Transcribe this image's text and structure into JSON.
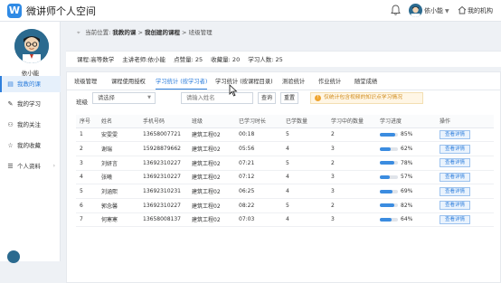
{
  "header": {
    "logo_letter": "W",
    "title": "微讲师个人空间",
    "user_name": "依小能",
    "org_label": "我的机构"
  },
  "sidebar": {
    "user_name": "依小能",
    "items": [
      {
        "label": "我教的课",
        "icon": "book-icon",
        "glyph": "▤"
      },
      {
        "label": "我的学习",
        "icon": "study-icon",
        "glyph": "✎"
      },
      {
        "label": "我的关注",
        "icon": "person-icon",
        "glyph": "⚇"
      },
      {
        "label": "我的收藏",
        "icon": "star-icon",
        "glyph": "☆"
      },
      {
        "label": "个人资料",
        "icon": "profile-icon",
        "glyph": "☰"
      }
    ]
  },
  "breadcrumb": {
    "prefix": "当前位置:",
    "level1": "我教的课",
    "sep": ">",
    "level2": "我创建的课程",
    "level3": "班级管理"
  },
  "course_info": {
    "course": "课程:高等数学",
    "teacher": "主讲老师:依小能",
    "likes": "点赞量: 25",
    "favorites": "收藏量: 20",
    "learners": "学习人数: 25"
  },
  "tabs": [
    {
      "label": "班级管理"
    },
    {
      "label": "课程使用授权"
    },
    {
      "label": "学习统计 (按学习者)"
    },
    {
      "label": "学习统计 (按课程目录)"
    },
    {
      "label": "测验统计"
    },
    {
      "label": "作业统计"
    },
    {
      "label": "随堂成绩"
    }
  ],
  "filters": {
    "class_label": "班级",
    "class_select": "请选择",
    "search_placeholder": "请输入姓名",
    "query_button": "查询",
    "reset_button": "重置",
    "notice": "仅统计包含视频的知识点学习情况"
  },
  "table": {
    "headers": [
      "序号",
      "姓名",
      "手机号码",
      "班级",
      "已学习时长",
      "已学数量",
      "学习中的数量",
      "学习进度",
      "操作"
    ],
    "rows": [
      {
        "no": "1",
        "name": "安雯雯",
        "phone": "13658007721",
        "class": "建筑工程02",
        "time": "00:18",
        "done": "5",
        "learning": "2",
        "progress": "85%",
        "pct": 0.85,
        "action": "查看详情"
      },
      {
        "no": "2",
        "name": "谢瑞",
        "phone": "15928879662",
        "class": "建筑工程02",
        "time": "05:56",
        "done": "4",
        "learning": "3",
        "progress": "62%",
        "pct": 0.62,
        "action": "查看详情"
      },
      {
        "no": "3",
        "name": "刘妍言",
        "phone": "13692310227",
        "class": "建筑工程02",
        "time": "07:21",
        "done": "5",
        "learning": "2",
        "progress": "78%",
        "pct": 0.78,
        "action": "查看详情"
      },
      {
        "no": "4",
        "name": "张曦",
        "phone": "13692310227",
        "class": "建筑工程02",
        "time": "07:12",
        "done": "4",
        "learning": "3",
        "progress": "57%",
        "pct": 0.57,
        "action": "查看详情"
      },
      {
        "no": "5",
        "name": "刘涵熙",
        "phone": "13692310231",
        "class": "建筑工程02",
        "time": "06:25",
        "done": "4",
        "learning": "3",
        "progress": "69%",
        "pct": 0.69,
        "action": "查看详情"
      },
      {
        "no": "6",
        "name": "郭念馨",
        "phone": "13692310227",
        "class": "建筑工程02",
        "time": "08:22",
        "done": "5",
        "learning": "2",
        "progress": "82%",
        "pct": 0.82,
        "action": "查看详情"
      },
      {
        "no": "7",
        "name": "何寒寒",
        "phone": "13658008137",
        "class": "建筑工程02",
        "time": "07:03",
        "done": "4",
        "learning": "3",
        "progress": "64%",
        "pct": 0.64,
        "action": "查看详情"
      }
    ]
  },
  "colors": {
    "accent": "#2f7fdc",
    "notice": "#d08b1a",
    "progress": "#3b8ce0"
  }
}
